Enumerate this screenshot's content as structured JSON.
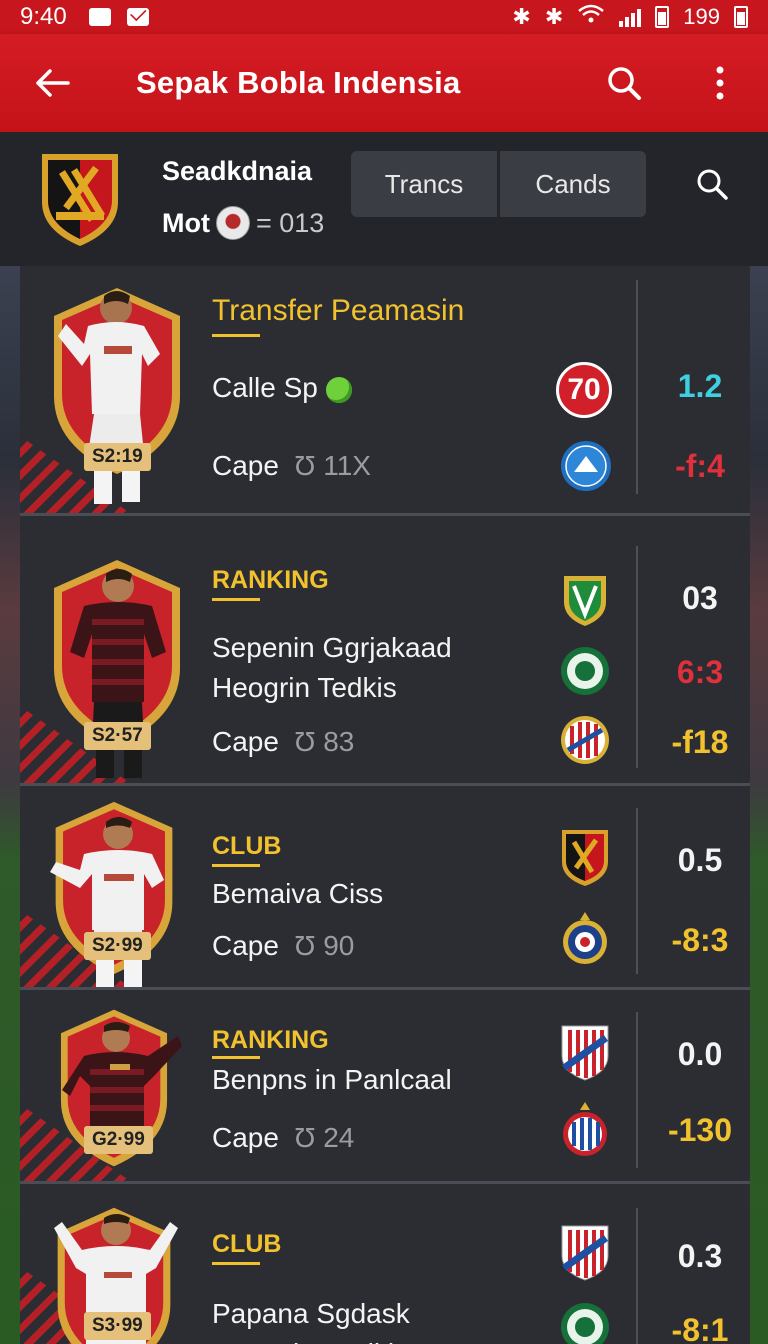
{
  "status_bar": {
    "time": "9:40",
    "battery": "199"
  },
  "app_bar": {
    "title": "Sepak Bobla Indensia"
  },
  "club_header": {
    "name": "Seadkdnaia",
    "meta_label": "Mot",
    "meta_value": "= 013",
    "tabs": [
      "Trancs",
      "Cands"
    ]
  },
  "cards": [
    {
      "category": "Transfer Peamasin",
      "name_lines": [
        "Calle Sp"
      ],
      "price": "S2:19",
      "cap_label": "Cape",
      "cap_value": "11X",
      "badge_top_value": "70",
      "stat_top": "1.2",
      "stat_bottom": "-f:4",
      "stat_top_color": "#3ed0e0",
      "stat_bottom_color": "#e0303b"
    },
    {
      "category": "RANKING",
      "name_lines": [
        "Sepenin Ggrjakaad",
        "Heogrin Tedkis"
      ],
      "price": "S2·57",
      "cap_label": "Cape",
      "cap_value": "83",
      "stat_1": "03",
      "stat_2": "6:3",
      "stat_3": "-f18"
    },
    {
      "category": "CLUB",
      "name_lines": [
        "Bemaiva Ciss"
      ],
      "price": "S2·99",
      "cap_label": "Cape",
      "cap_value": "90",
      "stat_top": "0.5",
      "stat_bottom": "-8:3"
    },
    {
      "category": "RANKING",
      "name_lines": [
        "Benpns in Panlcaal"
      ],
      "price": "G2·99",
      "cap_label": "Cape",
      "cap_value": "24",
      "stat_top": "0.0",
      "stat_bottom": "-130"
    },
    {
      "category": "CLUB",
      "name_lines": [
        "Papana Sgdask",
        "Benanin Dadkis"
      ],
      "price": "S3·99",
      "stat_top": "0.3",
      "stat_bottom": "-8:1"
    }
  ]
}
